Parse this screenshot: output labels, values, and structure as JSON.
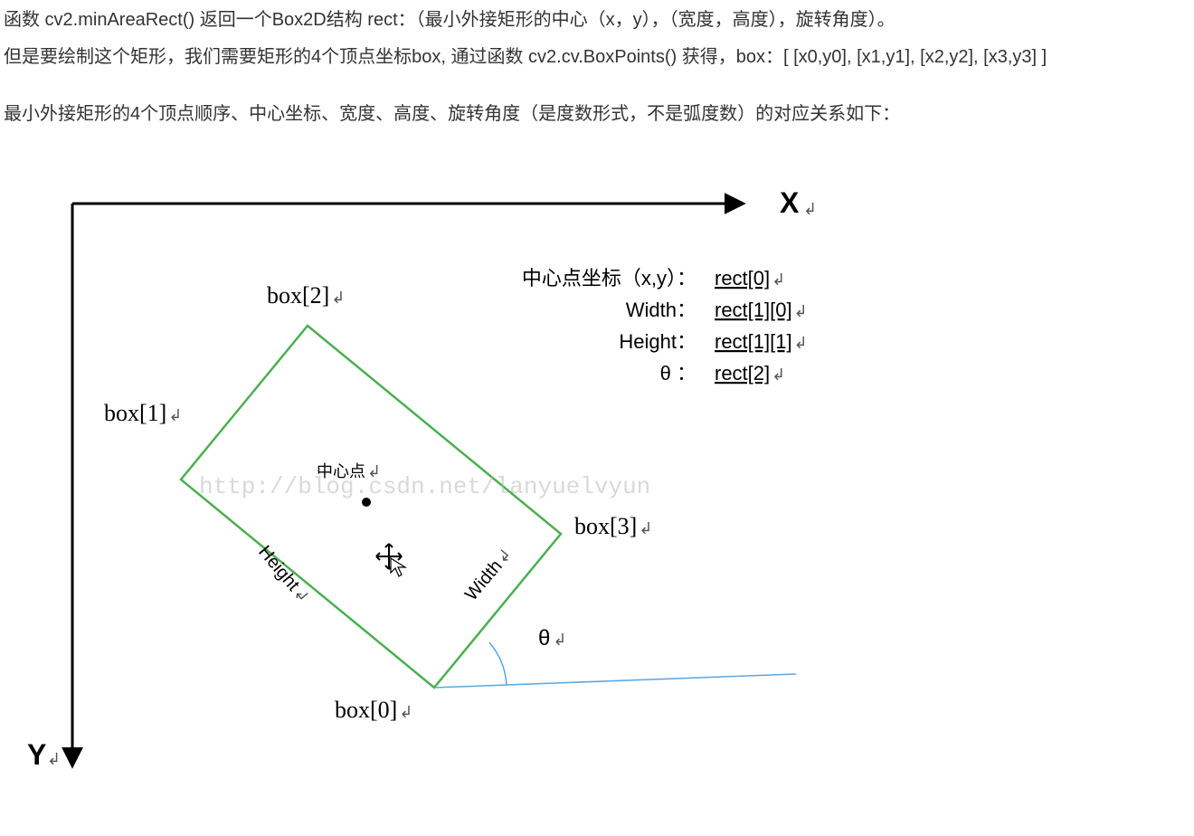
{
  "paragraphs": {
    "p1": "函数 cv2.minAreaRect() 返回一个Box2D结构 rect：（最小外接矩形的中心（x，y），（宽度，高度），旋转角度）。",
    "p2": "但是要绘制这个矩形，我们需要矩形的4个顶点坐标box, 通过函数 cv2.cv.BoxPoints() 获得，box：[ [x0,y0], [x1,y1], [x2,y2], [x3,y3] ]",
    "p3": "最小外接矩形的4个顶点顺序、中心坐标、宽度、高度、旋转角度（是度数形式，不是弧度数）的对应关系如下："
  },
  "axis": {
    "x": "X",
    "y": "Y"
  },
  "box": {
    "b0": "box[0]",
    "b1": "box[1]",
    "b2": "box[2]",
    "b3": "box[3]"
  },
  "labels": {
    "center": "中心点",
    "width": "Width",
    "height": "Height",
    "theta": "θ"
  },
  "legend": {
    "centerKey": "中心点坐标（x,y）：",
    "centerVal": "rect[0]",
    "widthKey": "Width：",
    "widthVal": "rect[1][0]",
    "heightKey": "Height：",
    "heightVal": "rect[1][1]",
    "thetaKey": "θ ：",
    "thetaVal": "rect[2]"
  },
  "watermark": "http://blog.csdn.net/lanyuelvyun",
  "ret": "↲"
}
